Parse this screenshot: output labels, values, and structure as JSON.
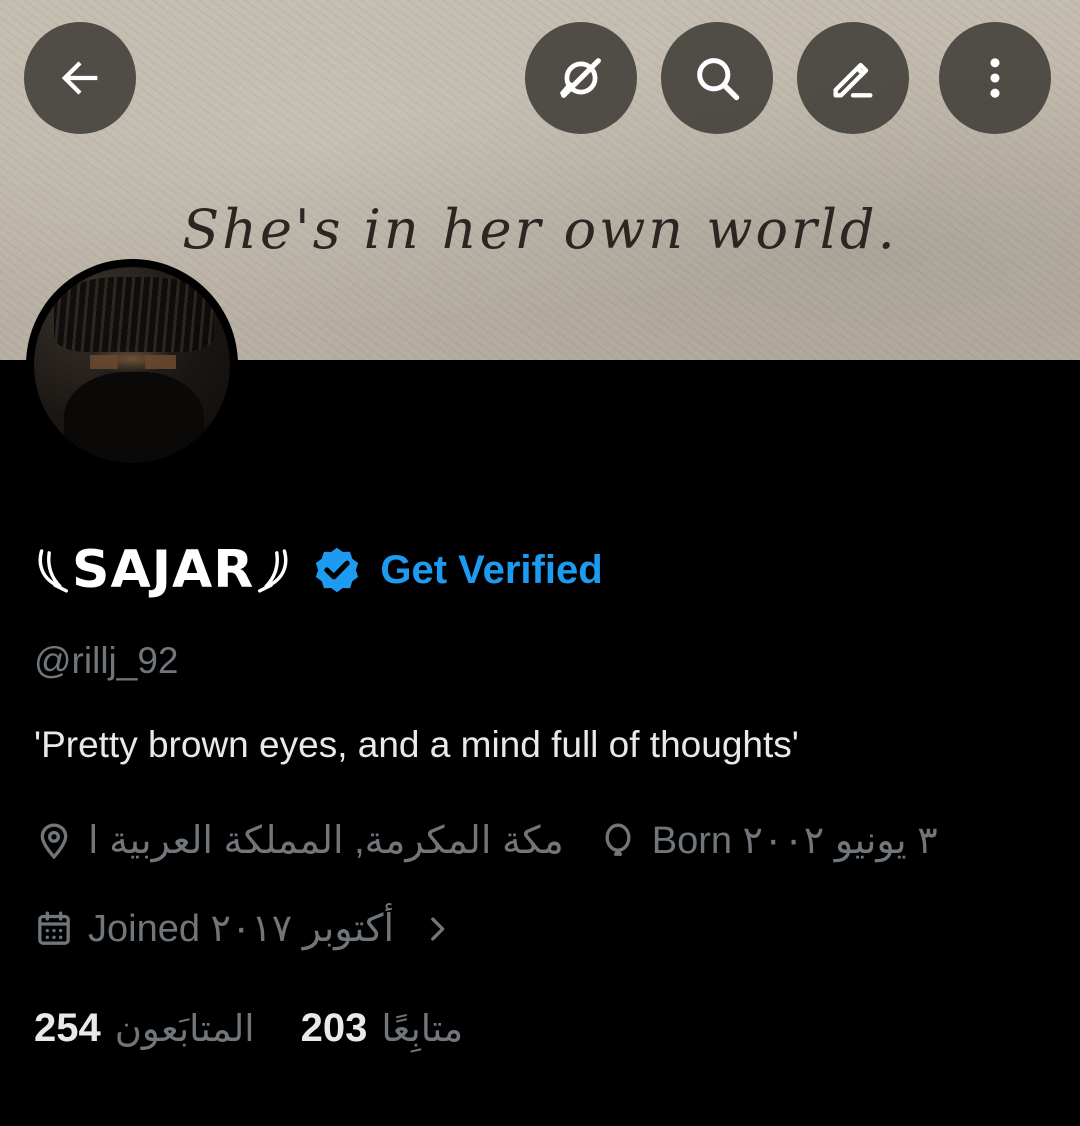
{
  "header": {
    "banner_text": "She's in her own world.",
    "back_icon": "arrow-left-icon",
    "grok_icon": "grok-icon",
    "search_icon": "search-icon",
    "edit_icon": "edit-icon",
    "more_icon": "more-vertical-icon"
  },
  "profile": {
    "display_name": "SAJAR",
    "get_verified": "Get Verified",
    "handle": "@rillj_92",
    "bio": "'Pretty brown eyes, and a mind full of thoughts'",
    "location": "مكة المكرمة, المملكة العربية ا",
    "birthday": "Born ٣ يونيو ٢٠٠٢",
    "joined": "Joined أكتوبر ٢٠١٧",
    "followers_count": "254",
    "followers_label": "المتابَعون",
    "following_count": "203",
    "following_label": "متابِعًا"
  },
  "colors": {
    "accent": "#1d9bf0",
    "muted": "#71767b",
    "text": "#e7e9ea",
    "background": "#000000"
  }
}
